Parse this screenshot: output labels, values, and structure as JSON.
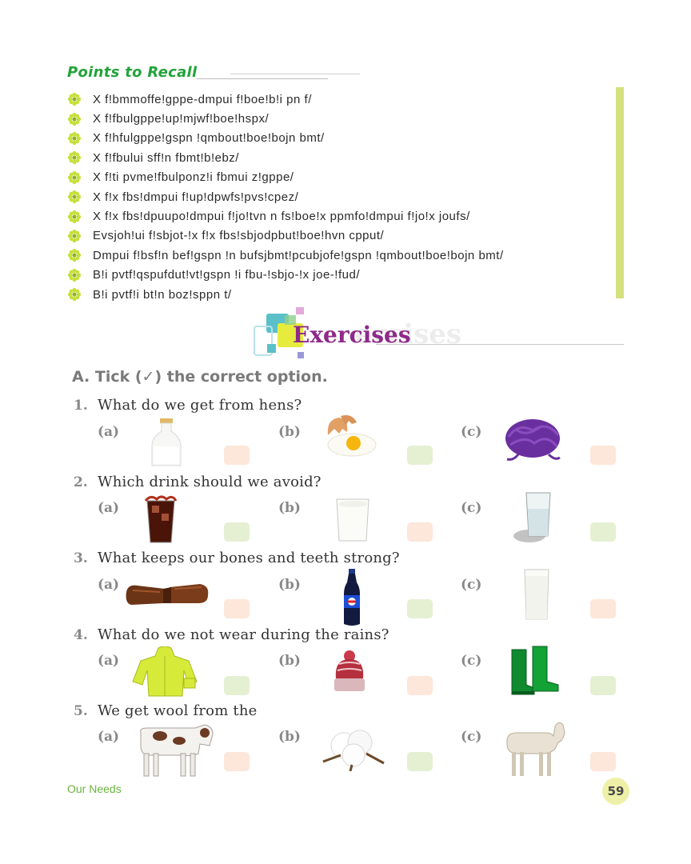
{
  "recall": {
    "title": "Points to Recall",
    "items": [
      "X f!bmmoffe!gppe-dmpui f!boe!b!i pn f/",
      "X f!fbulgppe!up!mjwf!boe!hspx/",
      "X f!hfulgppe!gspn !qmbout!boe!bojn bmt/",
      "X f!fbului sff!n fbmt!b!ebz/",
      "X f!ti pvme!fbulponz!i fbmui z!gppe/",
      "X f!x fbs!dmpui f!up!dpwfs!pvs!cpez/",
      "X f!x fbs!dpuupo!dmpui f!jo!tvn n fs!boe!x ppmfo!dmpui f!jo!x joufs/",
      "Evsjoh!ui f!sbjot-!x f!x fbs!sbjodpbut!boe!hvn cpput/",
      "Dmpui f!bsf!n bef!gspn !n bufsjbmt!pcubjofe!gspn !qmbout!boe!bojn bmt/",
      "B!i pvtf!qspufdut!vt!gspn !i fbu-!sbjo-!x joe-!fud/",
      "B!i pvtf!i bt!n boz!sppn t/"
    ]
  },
  "exercises": {
    "title": "Exercises",
    "ghost": "ercises",
    "section_a": "A.  Tick (✓) the correct option.",
    "questions": [
      {
        "num": "1.",
        "text": "What do we get from hens?",
        "options": [
          {
            "label": "(a)",
            "image": "milk-bottle"
          },
          {
            "label": "(b)",
            "image": "broken-egg"
          },
          {
            "label": "(c)",
            "image": "purple-wool"
          }
        ]
      },
      {
        "num": "2.",
        "text": "Which drink should we avoid?",
        "options": [
          {
            "label": "(a)",
            "image": "cola-glass"
          },
          {
            "label": "(b)",
            "image": "milk-glass"
          },
          {
            "label": "(c)",
            "image": "water-glass"
          }
        ]
      },
      {
        "num": "3.",
        "text": "What keeps our bones and teeth strong?",
        "options": [
          {
            "label": "(a)",
            "image": "chocolate-bar"
          },
          {
            "label": "(b)",
            "image": "soda-bottle"
          },
          {
            "label": "(c)",
            "image": "milk-glass"
          }
        ]
      },
      {
        "num": "4.",
        "text": "What do we not wear during the rains?",
        "options": [
          {
            "label": "(a)",
            "image": "raincoat"
          },
          {
            "label": "(b)",
            "image": "woollen-cap"
          },
          {
            "label": "(c)",
            "image": "gumboots"
          }
        ]
      },
      {
        "num": "5.",
        "text": "We get wool from the",
        "options": [
          {
            "label": "(a)",
            "image": "cow"
          },
          {
            "label": "(b)",
            "image": "cotton-boll"
          },
          {
            "label": "(c)",
            "image": "sheep"
          }
        ]
      }
    ]
  },
  "footer": {
    "chapter": "Our Needs",
    "page": "59"
  },
  "colors": {
    "recall_title": "#22a33a",
    "exercise_title": "#8e2a8a",
    "side_bar": "#d5e17d",
    "peach_box": "#fde6da",
    "green_box": "#e5f0d3"
  }
}
